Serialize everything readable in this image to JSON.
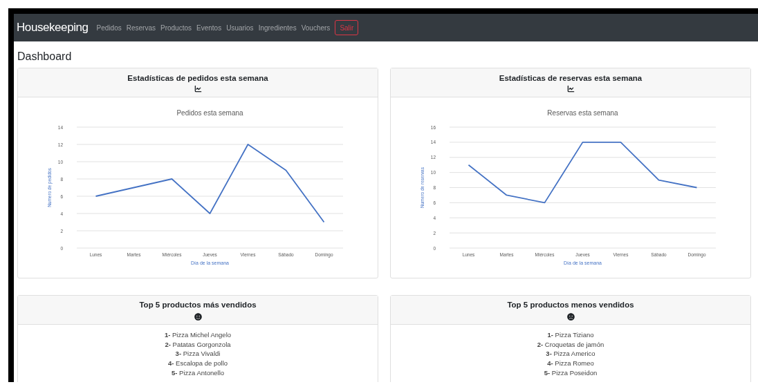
{
  "navbar": {
    "brand": "Housekeeping",
    "links": [
      "Pedidos",
      "Reservas",
      "Productos",
      "Eventos",
      "Usuarios",
      "Ingredientes",
      "Vouchers"
    ],
    "logout": "Salir"
  },
  "page_title": "Dashboard",
  "stat_cards": [
    {
      "title": "Estadísticas de pedidos esta semana",
      "chart_data": {
        "type": "line",
        "title": "Pedidos esta semana",
        "xlabel": "Día de la semana",
        "ylabel": "Numero de pedidos",
        "categories": [
          "Lunes",
          "Martes",
          "Miércoles",
          "Jueves",
          "Viernes",
          "Sábado",
          "Domingo"
        ],
        "series": [
          {
            "color": "#4472c4",
            "values": [
              6,
              7,
              8,
              4,
              12,
              9,
              3
            ]
          }
        ],
        "grid": true,
        "ylim": [
          0,
          14
        ],
        "yticks": [
          0,
          2,
          4,
          6,
          8,
          10,
          12,
          14
        ]
      }
    },
    {
      "title": "Estadísticas de reservas esta semana",
      "chart_data": {
        "type": "line",
        "title": "Reservas esta semana",
        "xlabel": "Día de la semana",
        "ylabel": "Numero de reservas",
        "categories": [
          "Lunes",
          "Martes",
          "Miércoles",
          "Jueves",
          "Viernes",
          "Sábado",
          "Domingo"
        ],
        "series": [
          {
            "color": "#4472c4",
            "values": [
              11,
              7,
              6,
              14,
              14,
              9,
              8
            ]
          }
        ],
        "grid": true,
        "ylim": [
          0,
          16
        ],
        "yticks": [
          0,
          2,
          4,
          6,
          8,
          10,
          12,
          14,
          16
        ]
      }
    }
  ],
  "product_cards": [
    {
      "title": "Top 5 productos más vendidos",
      "kind": "happy",
      "items": [
        "**1-** Pizza Michel Angelo",
        "**2-** Patatas Gorgonzola",
        "**3-** Pizza Vivaldi",
        "**4-** Escalopa de pollo",
        "**5-** Pizza Antonello"
      ]
    },
    {
      "title": "Top 5 productos menos vendidos",
      "kind": "sad",
      "items": [
        "**1-** Pizza Tiziano",
        "**2-** Croquetas de jamón",
        "**3-** Pizza Americo",
        "**4-** Pizza Romeo",
        "**5-** Pizza Poseidon"
      ]
    }
  ]
}
